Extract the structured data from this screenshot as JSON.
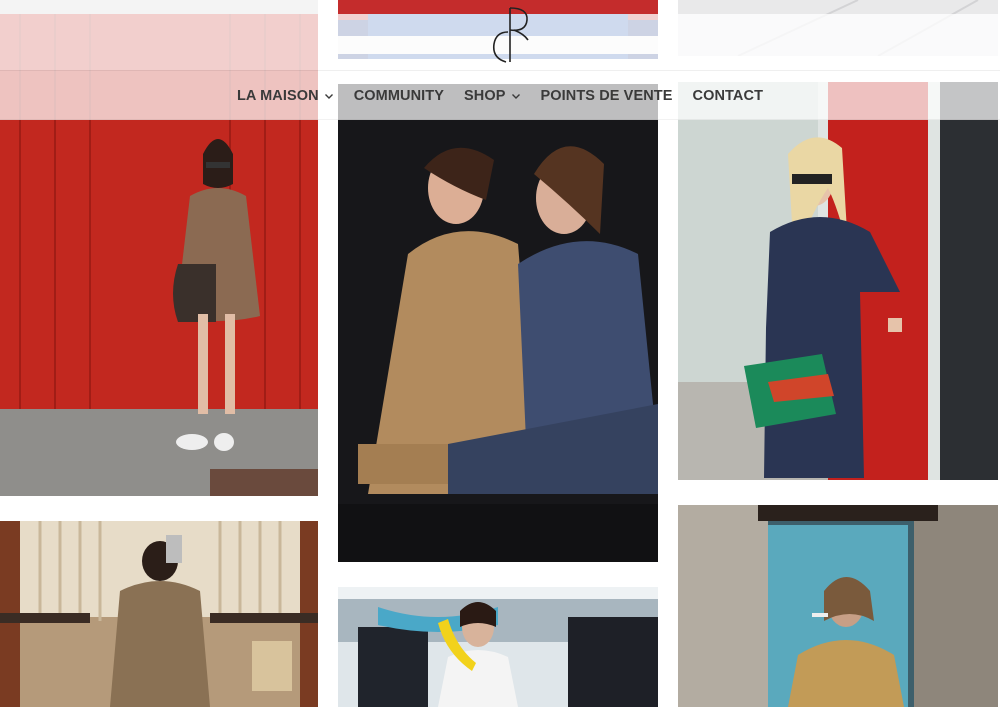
{
  "brand": {
    "logo_alt": "Cé logo"
  },
  "nav": {
    "items": [
      {
        "label": "LA MAISON",
        "has_dropdown": true
      },
      {
        "label": "COMMUNITY",
        "has_dropdown": false
      },
      {
        "label": "SHOP",
        "has_dropdown": true
      },
      {
        "label": "POINTS DE VENTE",
        "has_dropdown": false
      },
      {
        "label": "CONTACT",
        "has_dropdown": false
      }
    ]
  },
  "colors": {
    "nav_text": "#3a3a3a",
    "header_overlay": "rgba(255,255,255,0.72)",
    "page_bg": "#ffffff"
  },
  "gallery": {
    "photos": [
      {
        "name": "photo-woman-brown-jumpsuit-red-wall",
        "subject": "woman in brown jumpsuit against red wall"
      },
      {
        "name": "photo-two-women-jumpsuits",
        "subject": "two women sitting back to back in jumpsuits"
      },
      {
        "name": "photo-woman-navy-jumpsuit-red-door",
        "subject": "woman in navy jumpsuit with green clutch"
      },
      {
        "name": "photo-mirror-selfie-khaki",
        "subject": "mirror selfie in khaki dress"
      },
      {
        "name": "photo-woman-banana-store",
        "subject": "woman holding a yellow banana in a store"
      },
      {
        "name": "photo-woman-gold-jacket-window",
        "subject": "woman in gold jacket by a window"
      }
    ]
  }
}
